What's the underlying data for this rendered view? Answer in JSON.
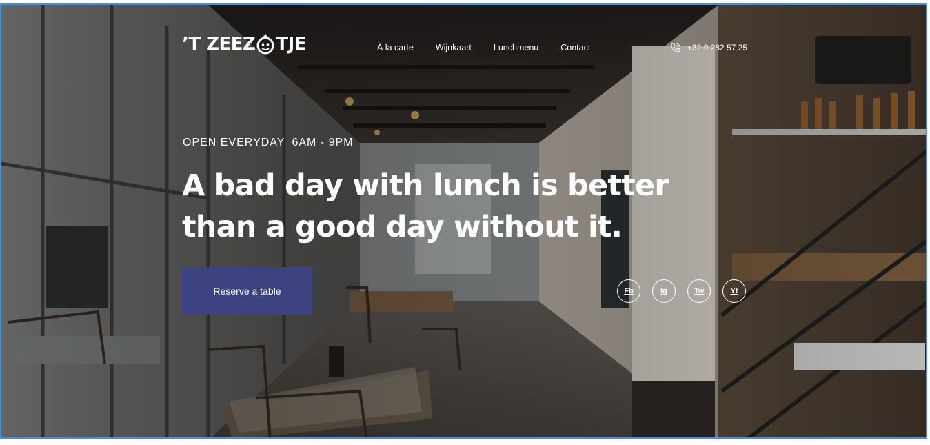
{
  "brand": {
    "name_left": "’T ZEEZ",
    "name_right": "TJE"
  },
  "nav": {
    "items": [
      {
        "label": "À la carte"
      },
      {
        "label": "Wijnkaart"
      },
      {
        "label": "Lunchmenu"
      },
      {
        "label": "Contact"
      }
    ]
  },
  "contact": {
    "phone": "+32 9 282 57 25",
    "icon": "phone-icon"
  },
  "hero": {
    "hours_label": "OPEN EVERYDAY",
    "hours_time": "6AM - 9PM",
    "headline": "A bad day with lunch is better than a good day without it.",
    "cta_label": "Reserve a table"
  },
  "socials": [
    {
      "label": "Fb"
    },
    {
      "label": "Ig"
    },
    {
      "label": "Tw"
    },
    {
      "label": "Yt"
    }
  ],
  "colors": {
    "cta_background": "#3d4380",
    "text": "#ffffff",
    "frame_border": "#4a8fd6"
  }
}
